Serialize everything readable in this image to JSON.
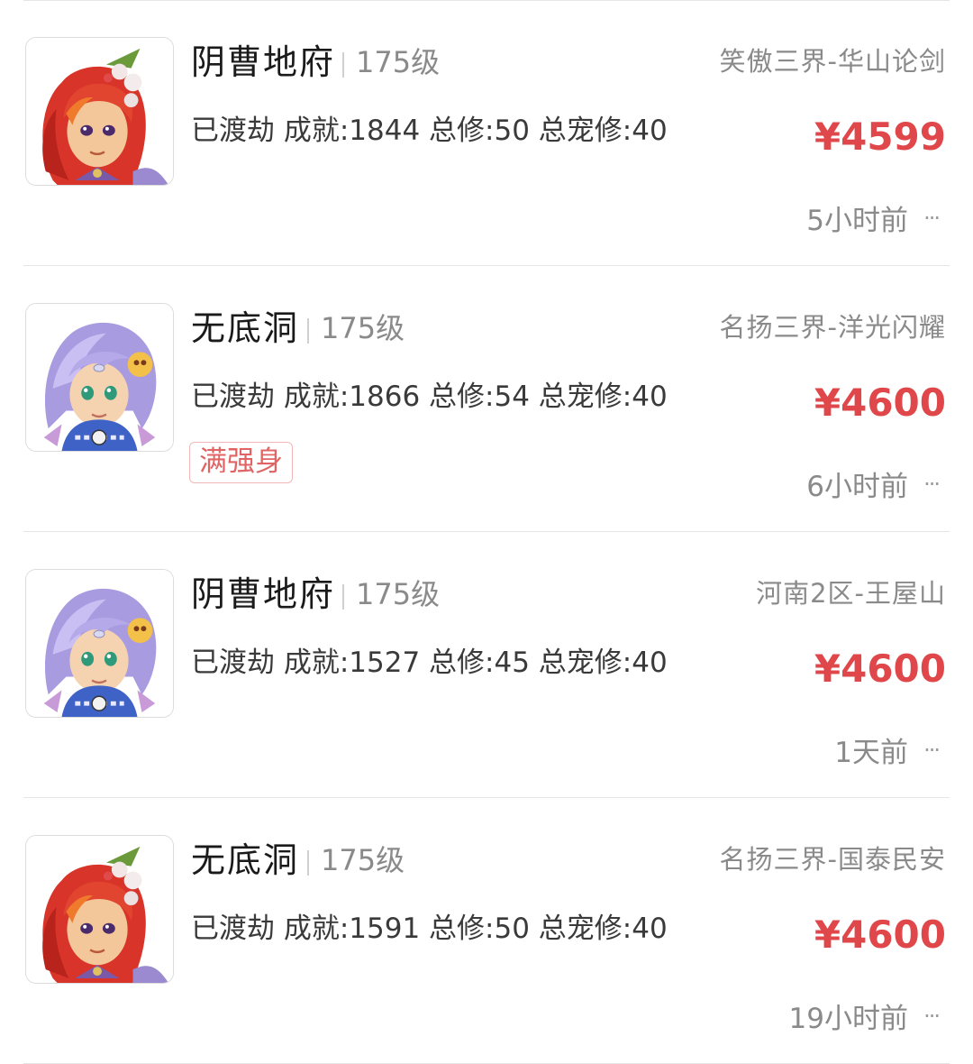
{
  "listings": [
    {
      "avatar": "red-hair-female-avatar",
      "name": "阴曹地府",
      "level": "175级",
      "server": "笑傲三界-华山论剑",
      "stats": "已渡劫 成就:1844 总修:50 总宠修:40",
      "price": "¥4599",
      "tag": "",
      "time": "5小时前",
      "more": "···"
    },
    {
      "avatar": "lavender-hair-avatar",
      "name": "无底洞",
      "level": "175级",
      "server": "名扬三界-洋光闪耀",
      "stats": "已渡劫 成就:1866 总修:54 总宠修:40",
      "price": "¥4600",
      "tag": "满强身",
      "time": "6小时前",
      "more": "···"
    },
    {
      "avatar": "lavender-hair-avatar",
      "name": "阴曹地府",
      "level": "175级",
      "server": "河南2区-王屋山",
      "stats": "已渡劫 成就:1527 总修:45 总宠修:40",
      "price": "¥4600",
      "tag": "",
      "time": "1天前",
      "more": "···"
    },
    {
      "avatar": "red-hair-female-avatar",
      "name": "无底洞",
      "level": "175级",
      "server": "名扬三界-国泰民安",
      "stats": "已渡劫 成就:1591 总修:50 总宠修:40",
      "price": "¥4600",
      "tag": "",
      "time": "19小时前",
      "more": "···"
    }
  ],
  "colors": {
    "price": "#e0474a",
    "tag_text": "#e06464",
    "tag_border": "#f1b8b8",
    "secondary_text": "#8a8a8a",
    "divider": "#e6e6e6"
  }
}
